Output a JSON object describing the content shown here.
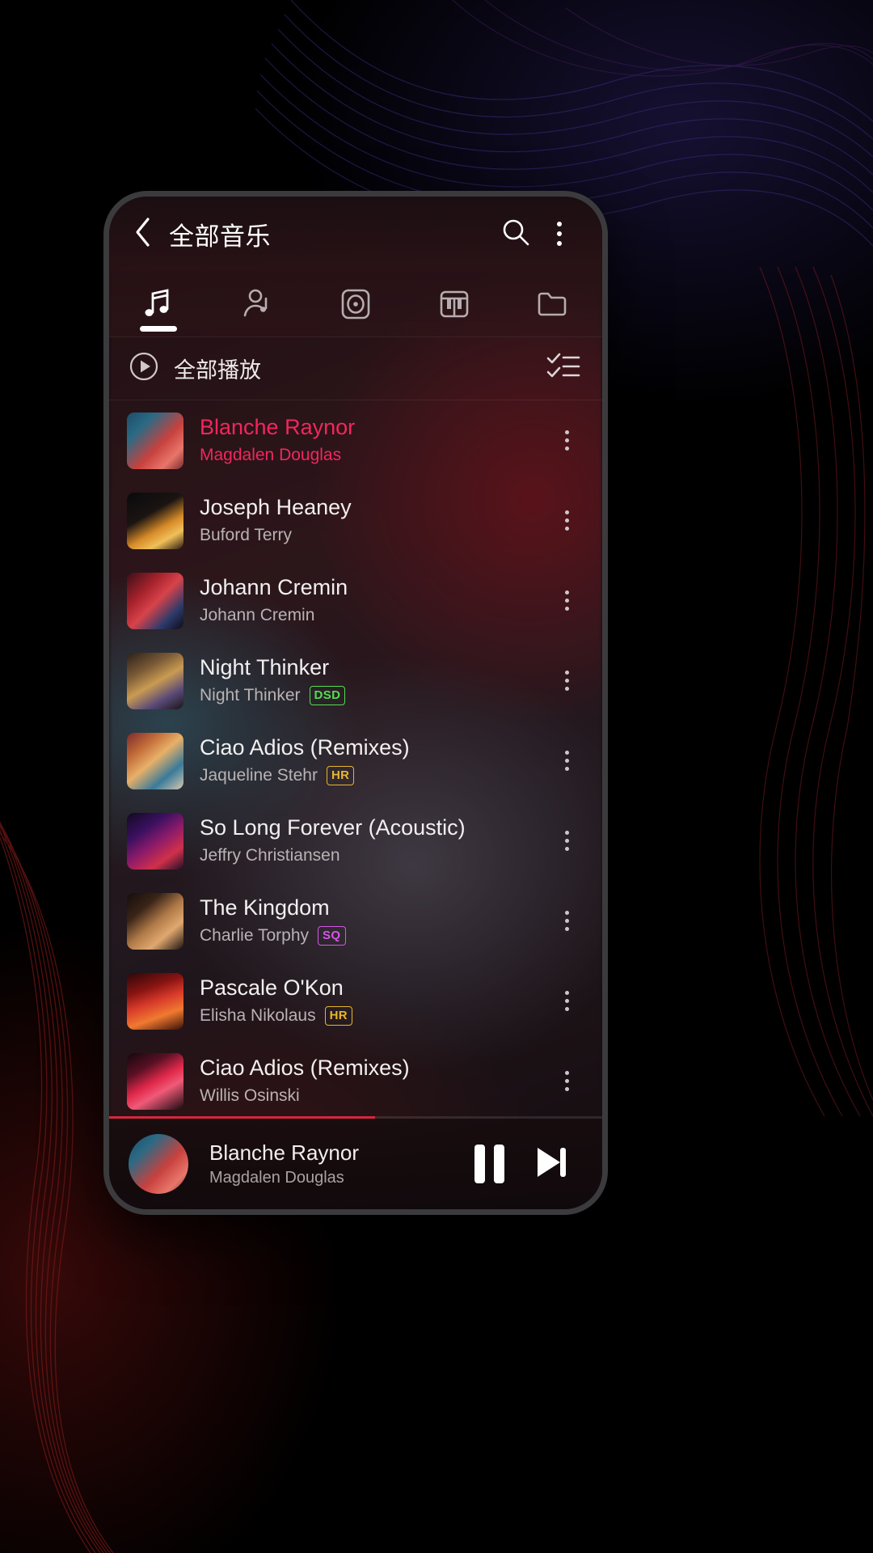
{
  "appbar": {
    "back_icon": "chevron-left-icon",
    "title": "全部音乐",
    "search_icon": "search-icon",
    "overflow_icon": "overflow-menu-icon"
  },
  "tabs": [
    {
      "name": "songs",
      "icon": "music-note-icon",
      "active": true
    },
    {
      "name": "artists",
      "icon": "artist-icon",
      "active": false
    },
    {
      "name": "albums",
      "icon": "album-disc-icon",
      "active": false
    },
    {
      "name": "genres",
      "icon": "piano-keys-icon",
      "active": false
    },
    {
      "name": "folders",
      "icon": "folder-icon",
      "active": false
    }
  ],
  "playall": {
    "play_icon": "play-circle-icon",
    "label": "全部播放",
    "multiselect_icon": "checklist-icon"
  },
  "songs": [
    {
      "title": "Blanche Raynor",
      "artist": "Magdalen Douglas",
      "badge": "",
      "art": "aw1",
      "current": true
    },
    {
      "title": "Joseph Heaney",
      "artist": "Buford Terry",
      "badge": "",
      "art": "aw2",
      "current": false
    },
    {
      "title": "Johann Cremin",
      "artist": "Johann Cremin",
      "badge": "",
      "art": "aw3",
      "current": false
    },
    {
      "title": "Night Thinker",
      "artist": "Night Thinker",
      "badge": "DSD",
      "art": "aw4",
      "current": false
    },
    {
      "title": "Ciao Adios (Remixes)",
      "artist": "Jaqueline Stehr",
      "badge": "HR",
      "art": "aw5",
      "current": false
    },
    {
      "title": "So Long Forever (Acoustic)",
      "artist": "Jeffry Christiansen",
      "badge": "",
      "art": "aw6",
      "current": false
    },
    {
      "title": "The Kingdom",
      "artist": "Charlie Torphy",
      "badge": "SQ",
      "art": "aw7",
      "current": false
    },
    {
      "title": "Pascale O'Kon",
      "artist": "Elisha Nikolaus",
      "badge": "HR",
      "art": "aw8",
      "current": false
    },
    {
      "title": "Ciao Adios (Remixes)",
      "artist": "Willis Osinski",
      "badge": "",
      "art": "aw9",
      "current": false
    }
  ],
  "miniplayer": {
    "title": "Blanche Raynor",
    "artist": "Magdalen Douglas",
    "art": "aw1",
    "progress_percent": 54,
    "pause_icon": "pause-icon",
    "next_icon": "skip-next-icon"
  },
  "colors": {
    "accent": "#f3265c",
    "progress": "#d7263d",
    "badge_dsd": "#53dd4f",
    "badge_hr": "#e8b62c",
    "badge_sq": "#d556e6"
  }
}
